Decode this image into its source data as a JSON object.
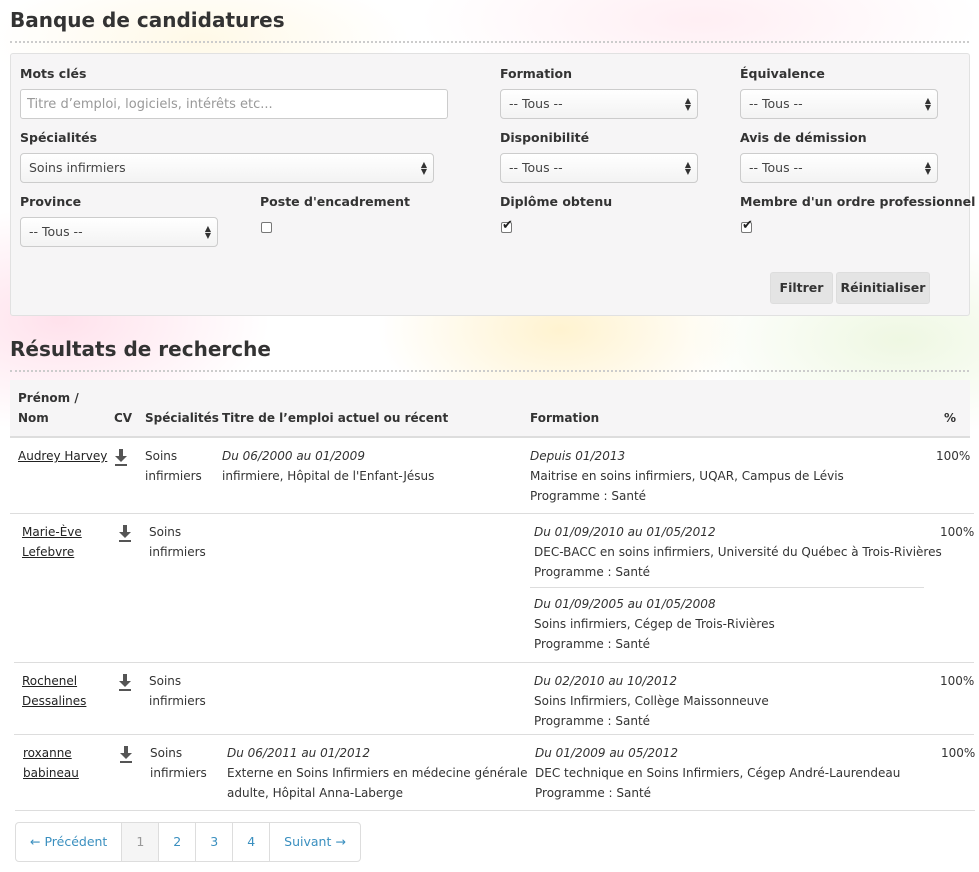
{
  "page": {
    "title": "Banque de candidatures"
  },
  "filters": {
    "keywords": {
      "label": "Mots clés",
      "placeholder": "Titre d’emploi, logiciels, intérêts etc..."
    },
    "formation": {
      "label": "Formation",
      "value": "-- Tous --"
    },
    "equivalence": {
      "label": "Équivalence",
      "value": "-- Tous --"
    },
    "specialites": {
      "label": "Spécialités",
      "value": "Soins infirmiers"
    },
    "disponibilite": {
      "label": "Disponibilité",
      "value": "-- Tous --"
    },
    "avis": {
      "label": "Avis de démission",
      "value": "-- Tous --"
    },
    "province": {
      "label": "Province",
      "value": "-- Tous --"
    },
    "poste": {
      "label": "Poste d'encadrement",
      "checked": false
    },
    "diplome": {
      "label": "Diplôme obtenu",
      "checked": true
    },
    "membre": {
      "label": "Membre d'un ordre professionnel",
      "checked": true
    },
    "filter_button": "Filtrer",
    "reset_button": "Réinitialiser"
  },
  "results": {
    "title": "Résultats de recherche",
    "headers": {
      "prenom": "Prénom /",
      "nom": "Nom",
      "cv": "CV",
      "specialites": "Spécialités",
      "titre": "Titre de l’emploi actuel ou récent",
      "formation": "Formation",
      "pct": "%"
    },
    "rows": [
      {
        "name": [
          "Audrey Harvey"
        ],
        "specialite": [
          "Soins",
          "infirmiers"
        ],
        "job_dates": "Du 06/2000 au 01/2009",
        "job_lines": [
          "infirmiere, Hôpital de l'Enfant-Jésus"
        ],
        "formations": [
          {
            "dates": "Depuis 01/2013",
            "lines": [
              "Maitrise en soins infirmiers, UQAR, Campus de Lévis",
              "Programme : Santé"
            ]
          }
        ],
        "pct": "100%"
      },
      {
        "name": [
          "Marie-Ève",
          "Lefebvre"
        ],
        "specialite": [
          "Soins",
          "infirmiers"
        ],
        "job_dates": "",
        "job_lines": [],
        "formations": [
          {
            "dates": "Du 01/09/2010 au 01/05/2012",
            "lines": [
              "DEC-BACC en soins infirmiers, Université du Québec à Trois-Rivières",
              "Programme : Santé"
            ]
          },
          {
            "dates": "Du 01/09/2005 au 01/05/2008",
            "lines": [
              "Soins infirmiers, Cégep de Trois-Rivières",
              "Programme : Santé"
            ]
          }
        ],
        "pct": "100%"
      },
      {
        "name": [
          "Rochenel",
          "Dessalines"
        ],
        "specialite": [
          "Soins",
          "infirmiers"
        ],
        "job_dates": "",
        "job_lines": [],
        "formations": [
          {
            "dates": "Du 02/2010 au 10/2012",
            "lines": [
              "Soins Infirmiers, Collège Maissonneuve",
              "Programme : Santé"
            ]
          }
        ],
        "pct": "100%"
      },
      {
        "name": [
          "roxanne",
          "babineau"
        ],
        "specialite": [
          "Soins",
          "infirmiers"
        ],
        "job_dates": "Du 06/2011 au 01/2012",
        "job_lines": [
          "Externe en Soins Infirmiers en médecine générale",
          "adulte, Hôpital Anna-Laberge"
        ],
        "formations": [
          {
            "dates": "Du 01/2009 au 05/2012",
            "lines": [
              "DEC technique en Soins Infirmiers, Cégep André-Laurendeau",
              "Programme : Santé"
            ]
          }
        ],
        "pct": "100%"
      }
    ]
  },
  "pagination": {
    "prev": "← Précédent",
    "pages": [
      "1",
      "2",
      "3",
      "4"
    ],
    "active_page": "1",
    "next": "Suivant →"
  }
}
